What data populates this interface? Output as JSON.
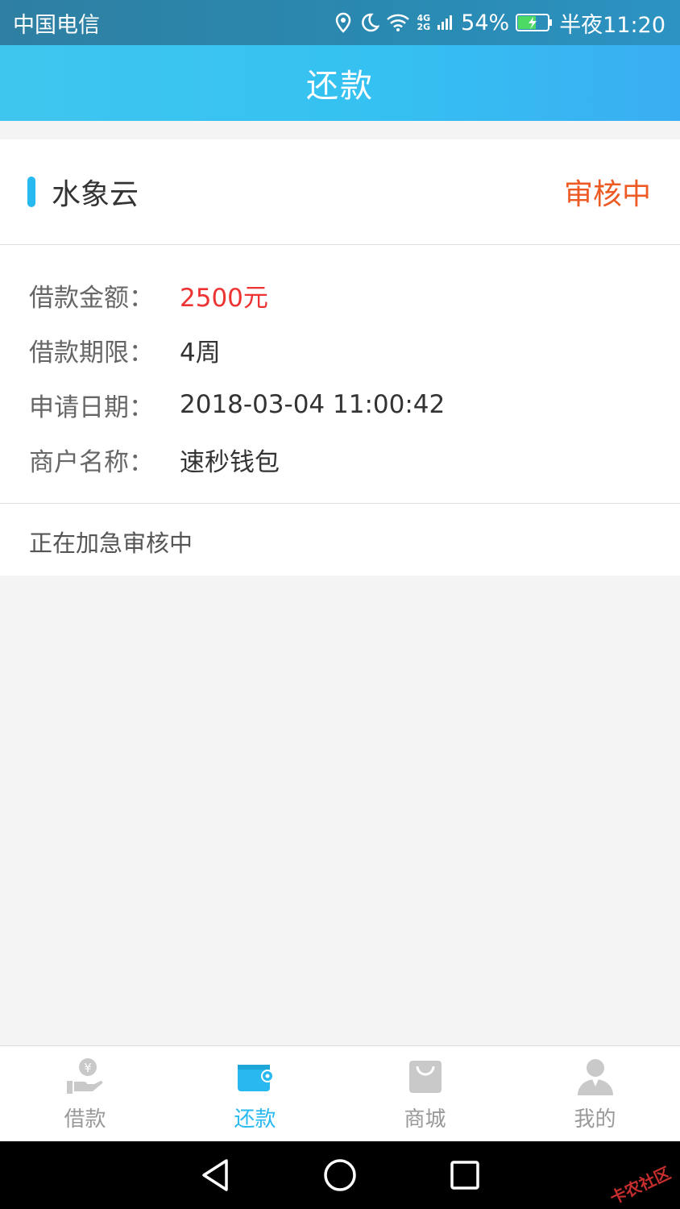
{
  "status_bar": {
    "carrier": "中国电信",
    "net_top": "4G",
    "net_bottom": "2G",
    "battery": "54%",
    "time": "半夜11:20"
  },
  "nav": {
    "title": "还款"
  },
  "loan": {
    "company": "水象云",
    "status": "审核中",
    "rows": [
      {
        "label": "借款金额：",
        "value": "2500元"
      },
      {
        "label": "借款期限：",
        "value": "4周"
      },
      {
        "label": "申请日期：",
        "value": "2018-03-04 11:00:42"
      },
      {
        "label": "商户名称：",
        "value": "速秒钱包"
      }
    ],
    "note": "正在加急审核中"
  },
  "tabs": [
    {
      "label": "借款",
      "icon": "hand-yen-icon"
    },
    {
      "label": "还款",
      "icon": "wallet-icon",
      "active": true
    },
    {
      "label": "商城",
      "icon": "shopping-bag-icon"
    },
    {
      "label": "我的",
      "icon": "user-icon"
    }
  ],
  "watermark": "卡农社区",
  "colors": {
    "accent": "#27b9ef",
    "status_orange": "#ee5a24",
    "amount_red": "#ee3333"
  }
}
